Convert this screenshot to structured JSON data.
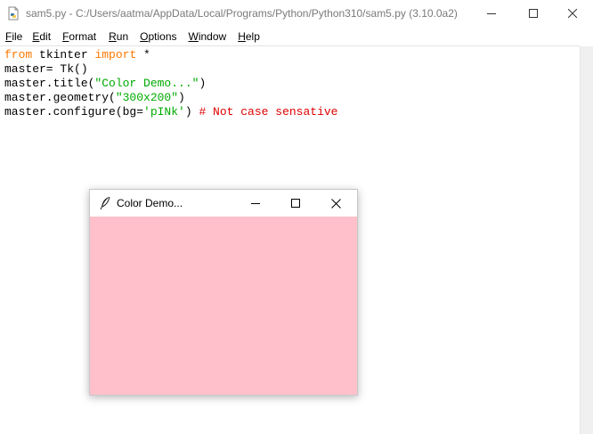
{
  "window": {
    "title": "sam5.py - C:/Users/aatma/AppData/Local/Programs/Python/Python310/sam5.py (3.10.0a2)"
  },
  "menu": [
    {
      "ul": "F",
      "rest": "ile"
    },
    {
      "ul": "E",
      "rest": "dit"
    },
    {
      "ul": "F",
      "rest": "ormat"
    },
    {
      "ul": "R",
      "rest": "un"
    },
    {
      "ul": "O",
      "rest": "ptions"
    },
    {
      "ul": "W",
      "rest": "indow"
    },
    {
      "ul": "H",
      "rest": "elp"
    }
  ],
  "code": {
    "line1": {
      "kw1": "from",
      "mid": " tkinter ",
      "kw2": "import",
      "tail": " *"
    },
    "line2": "master= Tk()",
    "line3": {
      "pre": "master.title(",
      "str": "\"Color Demo...\"",
      "post": ")"
    },
    "line4": {
      "pre": "master.geometry(",
      "str": "\"300x200\"",
      "post": ")"
    },
    "line5": {
      "pre": "master.configure(bg=",
      "str": "'pINk'",
      "post": ") ",
      "cmt": "# Not case sensative"
    }
  },
  "tk_window": {
    "title": "Color Demo...",
    "bg_color": "#ffc0cb"
  },
  "colors": {
    "keyword": "#ff7700",
    "string": "#00aa00",
    "comment": "#dd0000"
  },
  "icons": [
    "python-file-icon",
    "minimize-icon",
    "maximize-icon",
    "close-icon",
    "tk-feather-icon"
  ]
}
